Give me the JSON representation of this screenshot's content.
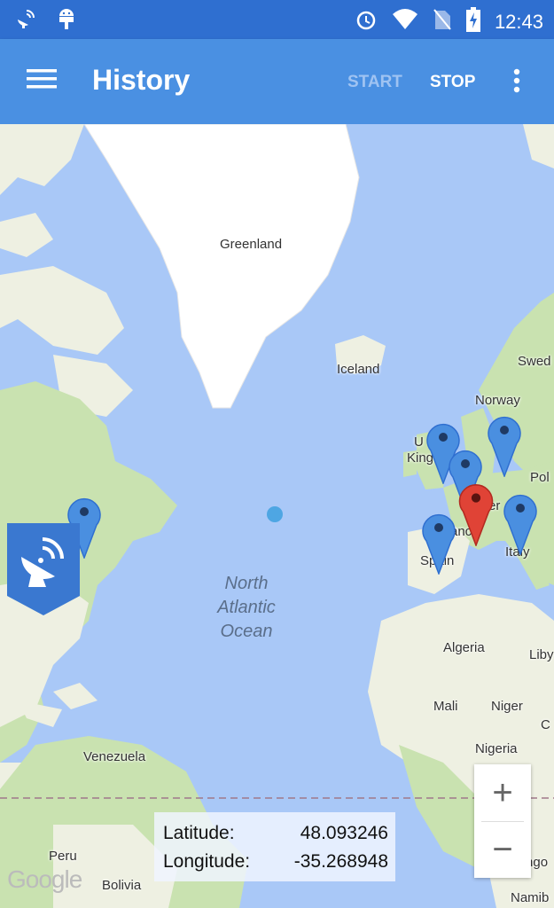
{
  "status_bar": {
    "icons_left": [
      "satellite-icon",
      "android-icon"
    ],
    "icons_right": [
      "alarm-icon",
      "wifi-icon",
      "no-sim-icon",
      "battery-charging-icon"
    ],
    "time": "12:43"
  },
  "app_bar": {
    "title": "History",
    "start_label": "START",
    "stop_label": "STOP"
  },
  "map": {
    "labels": {
      "greenland": "Greenland",
      "iceland": "Iceland",
      "norway": "Norway",
      "sweden": "Swed",
      "uk": "U",
      "uk2": "King",
      "poland": "Pol",
      "germany": "er",
      "france": "rance",
      "spain": "Spain",
      "italy": "Italy",
      "algeria": "Algeria",
      "libya": "Liby",
      "mali": "Mali",
      "niger": "Niger",
      "nigeria": "Nigeria",
      "chad": "C",
      "venezuela": "Venezuela",
      "peru": "Peru",
      "bolivia": "Bolivia",
      "angola": "Ango",
      "namibia": "Namib"
    },
    "ocean_line1": "North",
    "ocean_line2": "Atlantic",
    "ocean_line3": "Ocean",
    "attribution": "Google",
    "colors": {
      "water": "#a9c8f7",
      "land": "#eef0e2",
      "forest": "#c9e2b0",
      "ice": "#ffffff",
      "marker_blue": "#4a8fe0",
      "marker_red": "#e04336"
    }
  },
  "coordinates": {
    "latitude_label": "Latitude:",
    "latitude_value": "48.093246",
    "longitude_label": "Longitude:",
    "longitude_value": "-35.268948"
  },
  "zoom": {
    "in_label": "+",
    "out_label": "−"
  }
}
